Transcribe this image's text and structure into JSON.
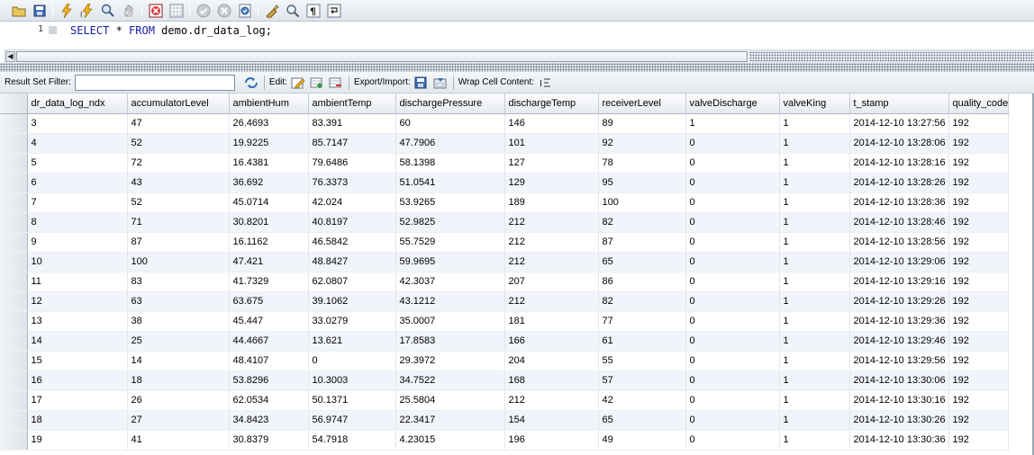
{
  "toolbar": {
    "icons": [
      "open-folder-icon",
      "save-icon",
      "execute-icon",
      "execute-current-icon",
      "explain-icon",
      "stop-icon",
      "toggle-error-icon",
      "grid-icon",
      "commit-icon",
      "rollback-icon",
      "autocommit-icon",
      "beautify-icon",
      "find-icon",
      "invisible-chars-icon",
      "wrap-icon"
    ]
  },
  "editor": {
    "line_number": "1",
    "keyword_select": "SELECT",
    "star": " * ",
    "keyword_from": "FROM",
    "table_ref": " demo.dr_data_log;"
  },
  "result_toolbar": {
    "filter_label": "Result Set Filter:",
    "filter_value": "",
    "edit_label": "Edit:",
    "export_label": "Export/Import:",
    "wrap_label": "Wrap Cell Content:"
  },
  "grid": {
    "columns": [
      "dr_data_log_ndx",
      "accumulatorLevel",
      "ambientHum",
      "ambientTemp",
      "dischargePressure",
      "dischargeTemp",
      "receiverLevel",
      "valveDischarge",
      "valveKing",
      "t_stamp",
      "quality_code"
    ],
    "rows": [
      [
        "3",
        "47",
        "26.4693",
        "83.391",
        "60",
        "146",
        "89",
        "1",
        "1",
        "2014-12-10 13:27:56",
        "192"
      ],
      [
        "4",
        "52",
        "19.9225",
        "85.7147",
        "47.7906",
        "101",
        "92",
        "0",
        "1",
        "2014-12-10 13:28:06",
        "192"
      ],
      [
        "5",
        "72",
        "16.4381",
        "79.6486",
        "58.1398",
        "127",
        "78",
        "0",
        "1",
        "2014-12-10 13:28:16",
        "192"
      ],
      [
        "6",
        "43",
        "36.692",
        "76.3373",
        "51.0541",
        "129",
        "95",
        "0",
        "1",
        "2014-12-10 13:28:26",
        "192"
      ],
      [
        "7",
        "52",
        "45.0714",
        "42.024",
        "53.9265",
        "189",
        "100",
        "0",
        "1",
        "2014-12-10 13:28:36",
        "192"
      ],
      [
        "8",
        "71",
        "30.8201",
        "40.8197",
        "52.9825",
        "212",
        "82",
        "0",
        "1",
        "2014-12-10 13:28:46",
        "192"
      ],
      [
        "9",
        "87",
        "16.1162",
        "46.5842",
        "55.7529",
        "212",
        "87",
        "0",
        "1",
        "2014-12-10 13:28:56",
        "192"
      ],
      [
        "10",
        "100",
        "47.421",
        "48.8427",
        "59.9695",
        "212",
        "65",
        "0",
        "1",
        "2014-12-10 13:29:06",
        "192"
      ],
      [
        "11",
        "83",
        "41.7329",
        "62.0807",
        "42.3037",
        "207",
        "86",
        "0",
        "1",
        "2014-12-10 13:29:16",
        "192"
      ],
      [
        "12",
        "63",
        "63.675",
        "39.1062",
        "43.1212",
        "212",
        "82",
        "0",
        "1",
        "2014-12-10 13:29:26",
        "192"
      ],
      [
        "13",
        "38",
        "45.447",
        "33.0279",
        "35.0007",
        "181",
        "77",
        "0",
        "1",
        "2014-12-10 13:29:36",
        "192"
      ],
      [
        "14",
        "25",
        "44.4667",
        "13.621",
        "17.8583",
        "166",
        "61",
        "0",
        "1",
        "2014-12-10 13:29:46",
        "192"
      ],
      [
        "15",
        "14",
        "48.4107",
        "0",
        "29.3972",
        "204",
        "55",
        "0",
        "1",
        "2014-12-10 13:29:56",
        "192"
      ],
      [
        "16",
        "18",
        "53.8296",
        "10.3003",
        "34.7522",
        "168",
        "57",
        "0",
        "1",
        "2014-12-10 13:30:06",
        "192"
      ],
      [
        "17",
        "26",
        "62.0534",
        "50.1371",
        "25.5804",
        "212",
        "42",
        "0",
        "1",
        "2014-12-10 13:30:16",
        "192"
      ],
      [
        "18",
        "27",
        "34.8423",
        "56.9747",
        "22.3417",
        "154",
        "65",
        "0",
        "1",
        "2014-12-10 13:30:26",
        "192"
      ],
      [
        "19",
        "41",
        "30.8379",
        "54.7918",
        "4.23015",
        "196",
        "49",
        "0",
        "1",
        "2014-12-10 13:30:36",
        "192"
      ]
    ]
  }
}
